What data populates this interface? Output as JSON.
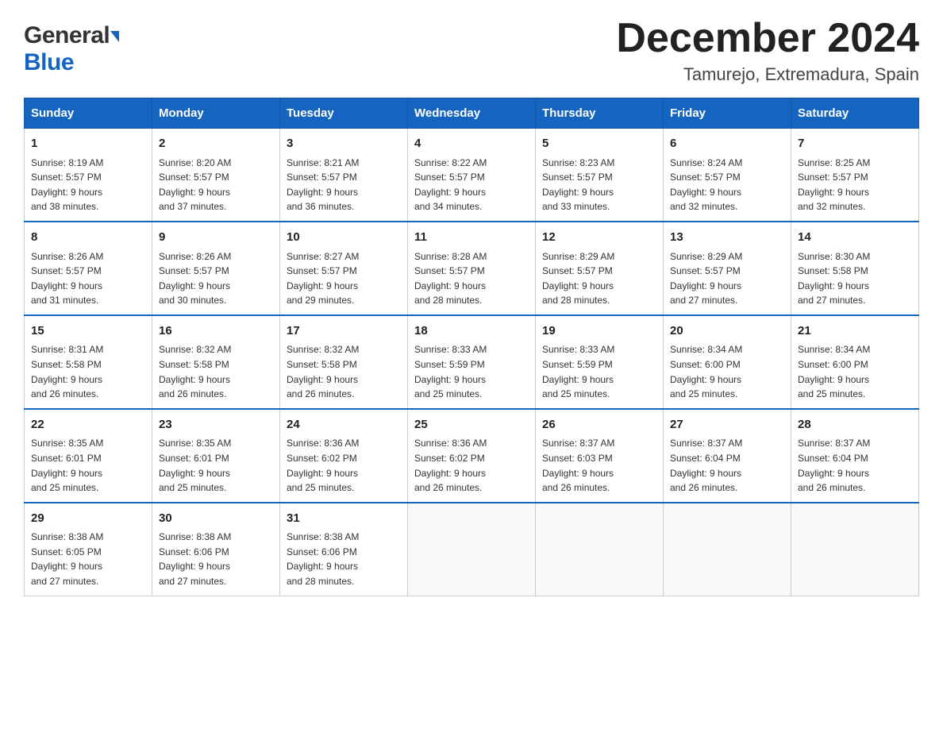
{
  "logo": {
    "general": "General",
    "blue": "Blue",
    "arrow": "▶"
  },
  "header": {
    "month": "December 2024",
    "location": "Tamurejo, Extremadura, Spain"
  },
  "days_of_week": [
    "Sunday",
    "Monday",
    "Tuesday",
    "Wednesday",
    "Thursday",
    "Friday",
    "Saturday"
  ],
  "weeks": [
    [
      {
        "num": "1",
        "sunrise": "8:19 AM",
        "sunset": "5:57 PM",
        "daylight": "9 hours and 38 minutes."
      },
      {
        "num": "2",
        "sunrise": "8:20 AM",
        "sunset": "5:57 PM",
        "daylight": "9 hours and 37 minutes."
      },
      {
        "num": "3",
        "sunrise": "8:21 AM",
        "sunset": "5:57 PM",
        "daylight": "9 hours and 36 minutes."
      },
      {
        "num": "4",
        "sunrise": "8:22 AM",
        "sunset": "5:57 PM",
        "daylight": "9 hours and 34 minutes."
      },
      {
        "num": "5",
        "sunrise": "8:23 AM",
        "sunset": "5:57 PM",
        "daylight": "9 hours and 33 minutes."
      },
      {
        "num": "6",
        "sunrise": "8:24 AM",
        "sunset": "5:57 PM",
        "daylight": "9 hours and 32 minutes."
      },
      {
        "num": "7",
        "sunrise": "8:25 AM",
        "sunset": "5:57 PM",
        "daylight": "9 hours and 32 minutes."
      }
    ],
    [
      {
        "num": "8",
        "sunrise": "8:26 AM",
        "sunset": "5:57 PM",
        "daylight": "9 hours and 31 minutes."
      },
      {
        "num": "9",
        "sunrise": "8:26 AM",
        "sunset": "5:57 PM",
        "daylight": "9 hours and 30 minutes."
      },
      {
        "num": "10",
        "sunrise": "8:27 AM",
        "sunset": "5:57 PM",
        "daylight": "9 hours and 29 minutes."
      },
      {
        "num": "11",
        "sunrise": "8:28 AM",
        "sunset": "5:57 PM",
        "daylight": "9 hours and 28 minutes."
      },
      {
        "num": "12",
        "sunrise": "8:29 AM",
        "sunset": "5:57 PM",
        "daylight": "9 hours and 28 minutes."
      },
      {
        "num": "13",
        "sunrise": "8:29 AM",
        "sunset": "5:57 PM",
        "daylight": "9 hours and 27 minutes."
      },
      {
        "num": "14",
        "sunrise": "8:30 AM",
        "sunset": "5:58 PM",
        "daylight": "9 hours and 27 minutes."
      }
    ],
    [
      {
        "num": "15",
        "sunrise": "8:31 AM",
        "sunset": "5:58 PM",
        "daylight": "9 hours and 26 minutes."
      },
      {
        "num": "16",
        "sunrise": "8:32 AM",
        "sunset": "5:58 PM",
        "daylight": "9 hours and 26 minutes."
      },
      {
        "num": "17",
        "sunrise": "8:32 AM",
        "sunset": "5:58 PM",
        "daylight": "9 hours and 26 minutes."
      },
      {
        "num": "18",
        "sunrise": "8:33 AM",
        "sunset": "5:59 PM",
        "daylight": "9 hours and 25 minutes."
      },
      {
        "num": "19",
        "sunrise": "8:33 AM",
        "sunset": "5:59 PM",
        "daylight": "9 hours and 25 minutes."
      },
      {
        "num": "20",
        "sunrise": "8:34 AM",
        "sunset": "6:00 PM",
        "daylight": "9 hours and 25 minutes."
      },
      {
        "num": "21",
        "sunrise": "8:34 AM",
        "sunset": "6:00 PM",
        "daylight": "9 hours and 25 minutes."
      }
    ],
    [
      {
        "num": "22",
        "sunrise": "8:35 AM",
        "sunset": "6:01 PM",
        "daylight": "9 hours and 25 minutes."
      },
      {
        "num": "23",
        "sunrise": "8:35 AM",
        "sunset": "6:01 PM",
        "daylight": "9 hours and 25 minutes."
      },
      {
        "num": "24",
        "sunrise": "8:36 AM",
        "sunset": "6:02 PM",
        "daylight": "9 hours and 25 minutes."
      },
      {
        "num": "25",
        "sunrise": "8:36 AM",
        "sunset": "6:02 PM",
        "daylight": "9 hours and 26 minutes."
      },
      {
        "num": "26",
        "sunrise": "8:37 AM",
        "sunset": "6:03 PM",
        "daylight": "9 hours and 26 minutes."
      },
      {
        "num": "27",
        "sunrise": "8:37 AM",
        "sunset": "6:04 PM",
        "daylight": "9 hours and 26 minutes."
      },
      {
        "num": "28",
        "sunrise": "8:37 AM",
        "sunset": "6:04 PM",
        "daylight": "9 hours and 26 minutes."
      }
    ],
    [
      {
        "num": "29",
        "sunrise": "8:38 AM",
        "sunset": "6:05 PM",
        "daylight": "9 hours and 27 minutes."
      },
      {
        "num": "30",
        "sunrise": "8:38 AM",
        "sunset": "6:06 PM",
        "daylight": "9 hours and 27 minutes."
      },
      {
        "num": "31",
        "sunrise": "8:38 AM",
        "sunset": "6:06 PM",
        "daylight": "9 hours and 28 minutes."
      },
      null,
      null,
      null,
      null
    ]
  ],
  "labels": {
    "sunrise": "Sunrise:",
    "sunset": "Sunset:",
    "daylight": "Daylight:"
  },
  "colors": {
    "header_bg": "#1565c0",
    "header_text": "#ffffff",
    "border": "#cccccc",
    "row_divider": "#1565c0"
  }
}
